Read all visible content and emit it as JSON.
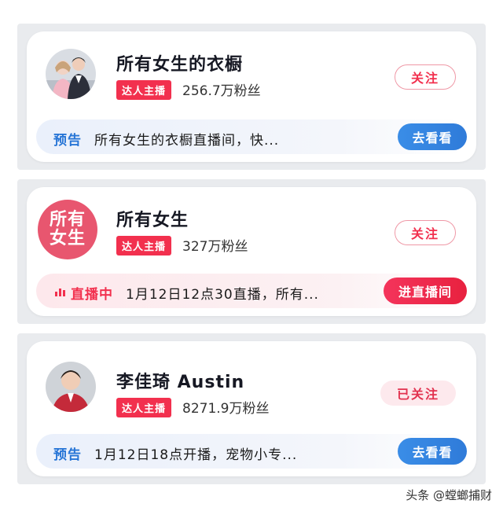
{
  "cards": [
    {
      "name": "所有女生的衣橱",
      "badge": "达人主播",
      "fans": "256.7万粉丝",
      "follow": "关注",
      "bar_tag": "预告",
      "bar_text": "所有女生的衣橱直播间，快...",
      "action": "去看看"
    },
    {
      "name": "所有女生",
      "badge": "达人主播",
      "fans": "327万粉丝",
      "follow": "关注",
      "bar_tag": "直播中",
      "bar_text": "1月12日12点30直播，所有...",
      "action": "进直播间",
      "logo_line1": "所有",
      "logo_line2": "女生"
    },
    {
      "name": "李佳琦 Austin",
      "badge": "达人主播",
      "fans": "8271.9万粉丝",
      "follow": "已关注",
      "bar_tag": "预告",
      "bar_text": "1月12日18点开播，宠物小专...",
      "action": "去看看"
    }
  ],
  "watermark": "头条 @螳螂捕财",
  "icons": {
    "live": "live-bars-icon",
    "avatar1": "couple-photo-avatar",
    "avatar3": "man-portrait-avatar"
  },
  "colors": {
    "accent_red": "#f2304e",
    "accent_blue": "#2f7bd9",
    "panel_bg": "#e9ebee"
  }
}
